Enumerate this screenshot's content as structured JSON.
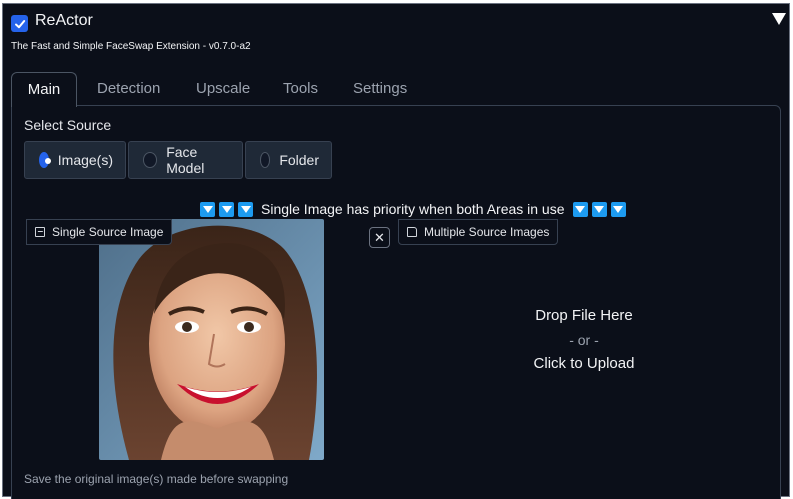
{
  "header": {
    "title": "ReActor",
    "subtitle": "The Fast and Simple FaceSwap Extension - v0.7.0-a2",
    "enabled": true
  },
  "tabs": [
    {
      "label": "Main",
      "active": true
    },
    {
      "label": "Detection"
    },
    {
      "label": "Upscale"
    },
    {
      "label": "Tools"
    },
    {
      "label": "Settings"
    }
  ],
  "select_source": {
    "label": "Select Source",
    "options": [
      {
        "label": "Image(s)",
        "checked": true
      },
      {
        "label": "Face Model"
      },
      {
        "label": "Folder"
      }
    ]
  },
  "priority_note": "Single Image has priority when both Areas in use",
  "single_source": {
    "label": "Single Source Image"
  },
  "multiple_source": {
    "label": "Multiple Source Images"
  },
  "dropzone": {
    "main": "Drop File Here",
    "or": "- or -",
    "click": "Click to Upload"
  },
  "save_note": "Save the original image(s) made before swapping",
  "colors": {
    "accent": "#2563eb",
    "panel_bg": "#0b0f19",
    "arrow_blue": "#1d9bf0"
  }
}
